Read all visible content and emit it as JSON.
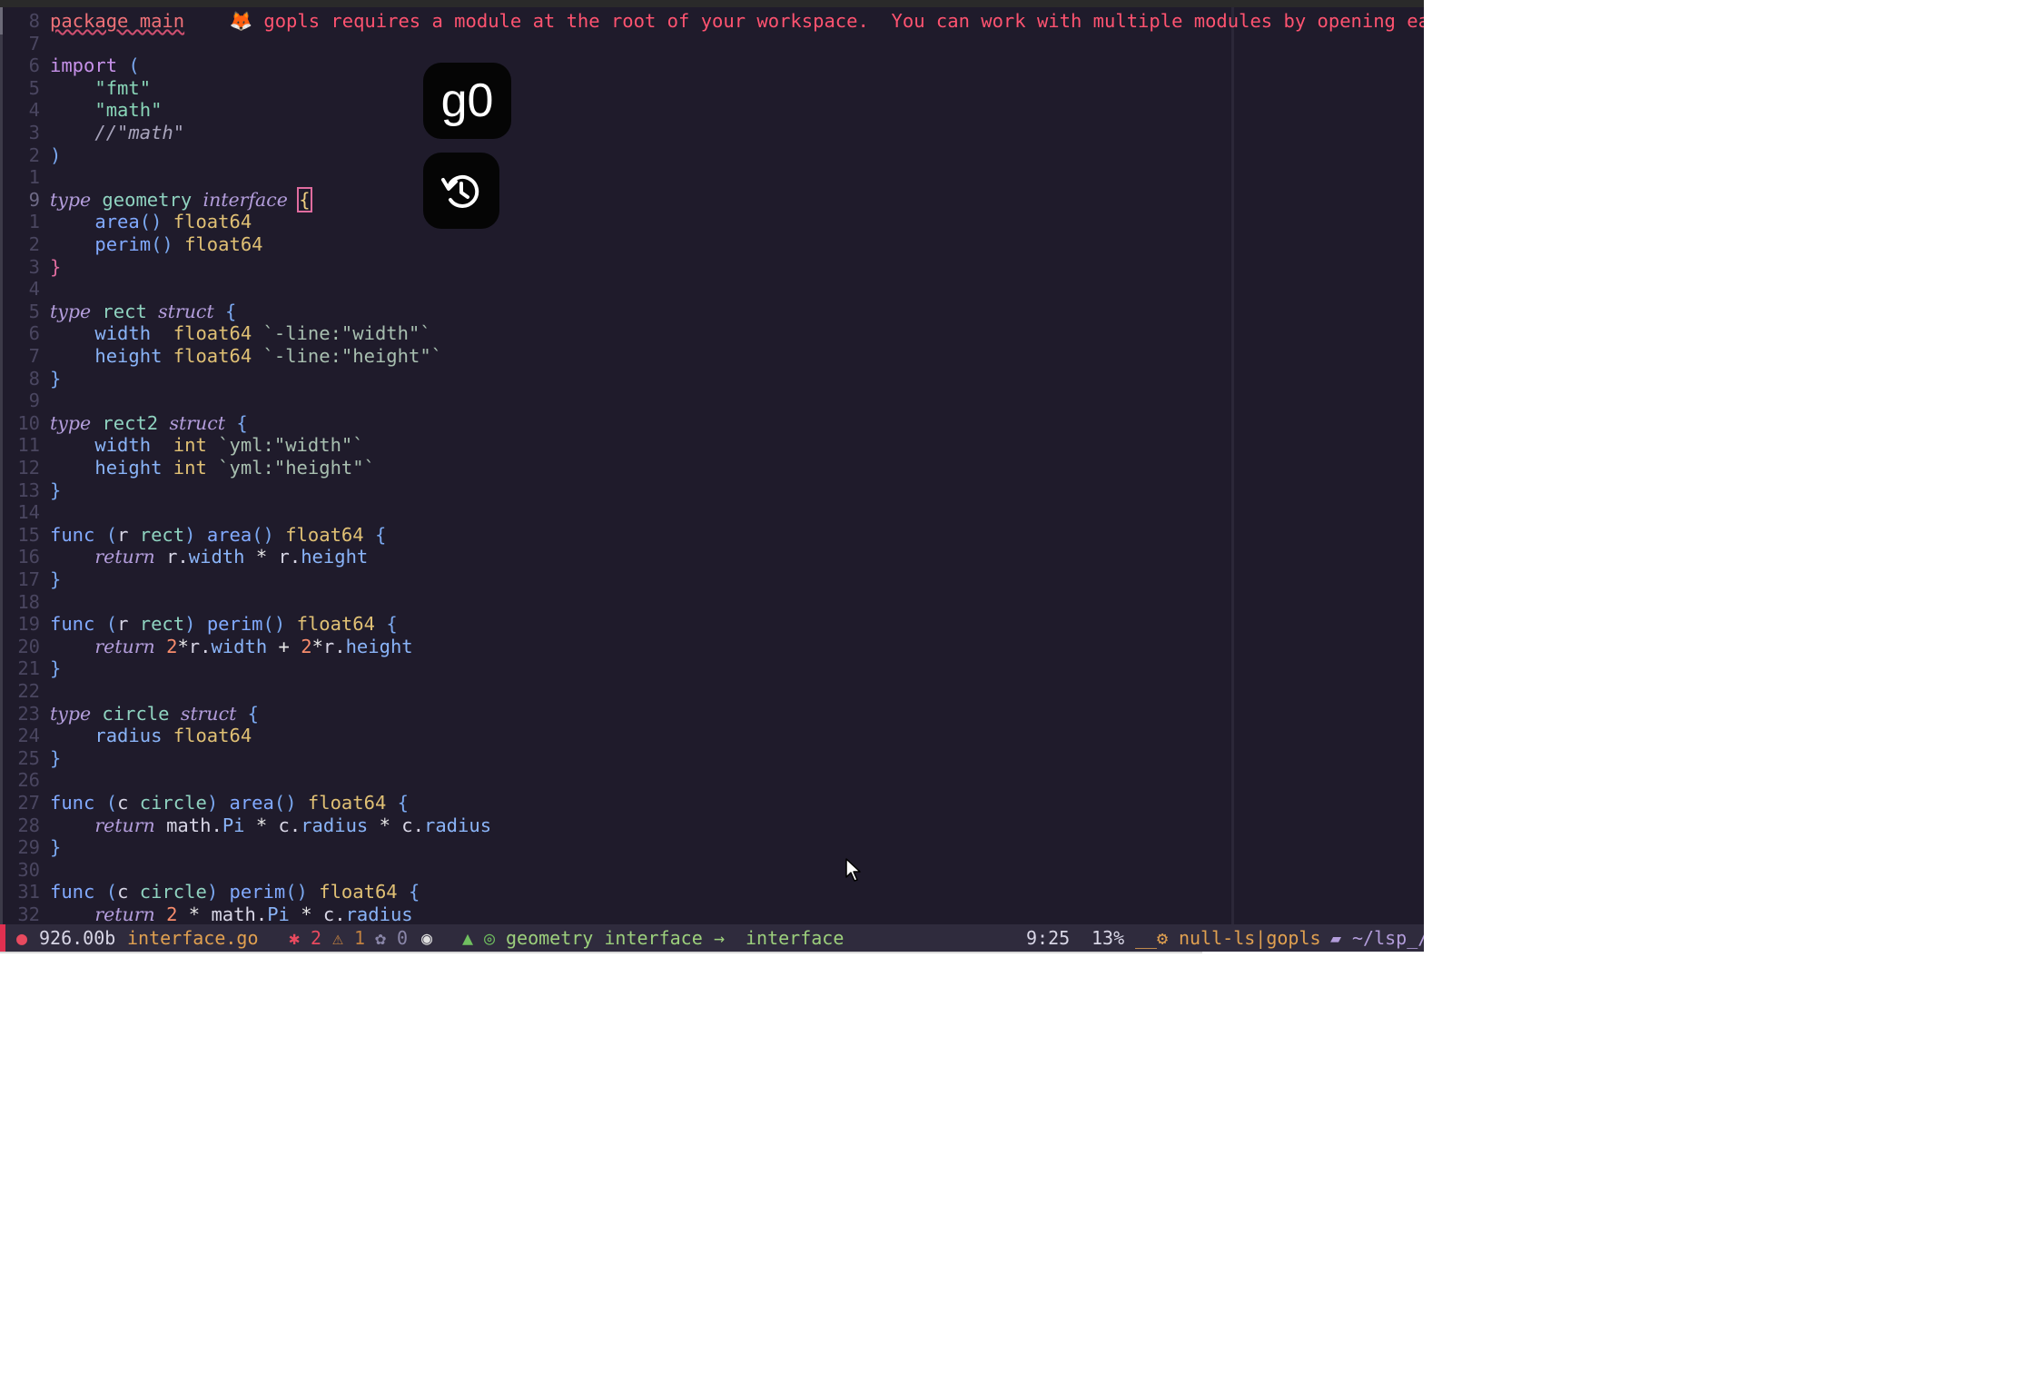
{
  "editor": {
    "lines": [
      {
        "num": "8",
        "tokens": [
          {
            "c": "pkgline",
            "t": "package main"
          },
          {
            "c": "txt",
            "t": "    "
          },
          {
            "c": "diagicon",
            "t": "🦊"
          },
          {
            "c": "diag",
            "t": " gopls requires a module at the root of your workspace.  You can work with multiple modules by opening each one as a workspace folder."
          }
        ]
      },
      {
        "num": "7",
        "tokens": []
      },
      {
        "num": "6",
        "tokens": [
          {
            "c": "kw",
            "t": "import"
          },
          {
            "c": "txt",
            "t": " "
          },
          {
            "c": "br",
            "t": "("
          }
        ]
      },
      {
        "num": "5",
        "tokens": [
          {
            "c": "txt",
            "t": "    "
          },
          {
            "c": "str",
            "t": "\"fmt\""
          }
        ]
      },
      {
        "num": "4",
        "tokens": [
          {
            "c": "txt",
            "t": "    "
          },
          {
            "c": "str",
            "t": "\"math\""
          }
        ]
      },
      {
        "num": "3",
        "tokens": [
          {
            "c": "txt",
            "t": "    "
          },
          {
            "c": "cmt",
            "t": "//\"math\""
          }
        ]
      },
      {
        "num": "2",
        "tokens": [
          {
            "c": "br",
            "t": ")"
          }
        ]
      },
      {
        "num": "1",
        "tokens": []
      },
      {
        "num": "9",
        "cur": true,
        "tokens": [
          {
            "c": "kwi",
            "t": "type"
          },
          {
            "c": "txt",
            "t": " "
          },
          {
            "c": "id",
            "t": "geometry"
          },
          {
            "c": "txt",
            "t": " "
          },
          {
            "c": "kwi",
            "t": "interface"
          },
          {
            "c": "txt",
            "t": " "
          },
          {
            "c": "bracehl",
            "t": "{"
          }
        ]
      },
      {
        "num": "1",
        "tokens": [
          {
            "c": "txt",
            "t": "    "
          },
          {
            "c": "fn",
            "t": "area"
          },
          {
            "c": "br",
            "t": "()"
          },
          {
            "c": "txt",
            "t": " "
          },
          {
            "c": "ty",
            "t": "float64"
          }
        ]
      },
      {
        "num": "2",
        "tokens": [
          {
            "c": "txt",
            "t": "    "
          },
          {
            "c": "fn",
            "t": "perim"
          },
          {
            "c": "br",
            "t": "()"
          },
          {
            "c": "txt",
            "t": " "
          },
          {
            "c": "ty",
            "t": "float64"
          }
        ]
      },
      {
        "num": "3",
        "tokens": [
          {
            "c": "bracepink",
            "t": "}"
          }
        ]
      },
      {
        "num": "4",
        "tokens": []
      },
      {
        "num": "5",
        "tokens": [
          {
            "c": "kwi",
            "t": "type"
          },
          {
            "c": "txt",
            "t": " "
          },
          {
            "c": "id",
            "t": "rect"
          },
          {
            "c": "txt",
            "t": " "
          },
          {
            "c": "kwi",
            "t": "struct"
          },
          {
            "c": "txt",
            "t": " "
          },
          {
            "c": "br",
            "t": "{"
          }
        ]
      },
      {
        "num": "6",
        "tokens": [
          {
            "c": "txt",
            "t": "    "
          },
          {
            "c": "fld",
            "t": "width"
          },
          {
            "c": "txt",
            "t": "  "
          },
          {
            "c": "ty",
            "t": "float64"
          },
          {
            "c": "txt",
            "t": " "
          },
          {
            "c": "tag",
            "t": "`-line:\"width\"`"
          }
        ]
      },
      {
        "num": "7",
        "tokens": [
          {
            "c": "txt",
            "t": "    "
          },
          {
            "c": "fld",
            "t": "height"
          },
          {
            "c": "txt",
            "t": " "
          },
          {
            "c": "ty",
            "t": "float64"
          },
          {
            "c": "txt",
            "t": " "
          },
          {
            "c": "tag",
            "t": "`-line:\"height\"`"
          }
        ]
      },
      {
        "num": "8",
        "tokens": [
          {
            "c": "br",
            "t": "}"
          }
        ]
      },
      {
        "num": "9",
        "tokens": []
      },
      {
        "num": "10",
        "tokens": [
          {
            "c": "kwi",
            "t": "type"
          },
          {
            "c": "txt",
            "t": " "
          },
          {
            "c": "id",
            "t": "rect2"
          },
          {
            "c": "txt",
            "t": " "
          },
          {
            "c": "kwi",
            "t": "struct"
          },
          {
            "c": "txt",
            "t": " "
          },
          {
            "c": "br",
            "t": "{"
          }
        ]
      },
      {
        "num": "11",
        "tokens": [
          {
            "c": "txt",
            "t": "    "
          },
          {
            "c": "fld",
            "t": "width"
          },
          {
            "c": "txt",
            "t": "  "
          },
          {
            "c": "ty",
            "t": "int"
          },
          {
            "c": "txt",
            "t": " "
          },
          {
            "c": "tag",
            "t": "`yml:\"width\"`"
          }
        ]
      },
      {
        "num": "12",
        "tokens": [
          {
            "c": "txt",
            "t": "    "
          },
          {
            "c": "fld",
            "t": "height"
          },
          {
            "c": "txt",
            "t": " "
          },
          {
            "c": "ty",
            "t": "int"
          },
          {
            "c": "txt",
            "t": " "
          },
          {
            "c": "tag",
            "t": "`yml:\"height\"`"
          }
        ]
      },
      {
        "num": "13",
        "tokens": [
          {
            "c": "br",
            "t": "}"
          }
        ]
      },
      {
        "num": "14",
        "tokens": []
      },
      {
        "num": "15",
        "tokens": [
          {
            "c": "fn",
            "t": "func"
          },
          {
            "c": "txt",
            "t": " "
          },
          {
            "c": "br",
            "t": "("
          },
          {
            "c": "txt",
            "t": "r "
          },
          {
            "c": "id",
            "t": "rect"
          },
          {
            "c": "br",
            "t": ")"
          },
          {
            "c": "txt",
            "t": " "
          },
          {
            "c": "fn",
            "t": "area"
          },
          {
            "c": "br",
            "t": "()"
          },
          {
            "c": "txt",
            "t": " "
          },
          {
            "c": "ty",
            "t": "float64"
          },
          {
            "c": "txt",
            "t": " "
          },
          {
            "c": "br",
            "t": "{"
          }
        ]
      },
      {
        "num": "16",
        "tokens": [
          {
            "c": "txt",
            "t": "    "
          },
          {
            "c": "kwi",
            "t": "return"
          },
          {
            "c": "txt",
            "t": " r."
          },
          {
            "c": "fld",
            "t": "width"
          },
          {
            "c": "txt",
            "t": " "
          },
          {
            "c": "op",
            "t": "*"
          },
          {
            "c": "txt",
            "t": " r."
          },
          {
            "c": "fld",
            "t": "height"
          }
        ]
      },
      {
        "num": "17",
        "tokens": [
          {
            "c": "br",
            "t": "}"
          }
        ]
      },
      {
        "num": "18",
        "tokens": []
      },
      {
        "num": "19",
        "tokens": [
          {
            "c": "fn",
            "t": "func"
          },
          {
            "c": "txt",
            "t": " "
          },
          {
            "c": "br",
            "t": "("
          },
          {
            "c": "txt",
            "t": "r "
          },
          {
            "c": "id",
            "t": "rect"
          },
          {
            "c": "br",
            "t": ")"
          },
          {
            "c": "txt",
            "t": " "
          },
          {
            "c": "fn",
            "t": "perim"
          },
          {
            "c": "br",
            "t": "()"
          },
          {
            "c": "txt",
            "t": " "
          },
          {
            "c": "ty",
            "t": "float64"
          },
          {
            "c": "txt",
            "t": " "
          },
          {
            "c": "br",
            "t": "{"
          }
        ]
      },
      {
        "num": "20",
        "tokens": [
          {
            "c": "txt",
            "t": "    "
          },
          {
            "c": "kwi",
            "t": "return"
          },
          {
            "c": "txt",
            "t": " "
          },
          {
            "c": "num",
            "t": "2"
          },
          {
            "c": "op",
            "t": "*"
          },
          {
            "c": "txt",
            "t": "r."
          },
          {
            "c": "fld",
            "t": "width"
          },
          {
            "c": "txt",
            "t": " "
          },
          {
            "c": "op",
            "t": "+"
          },
          {
            "c": "txt",
            "t": " "
          },
          {
            "c": "num",
            "t": "2"
          },
          {
            "c": "op",
            "t": "*"
          },
          {
            "c": "txt",
            "t": "r."
          },
          {
            "c": "fld",
            "t": "height"
          }
        ]
      },
      {
        "num": "21",
        "tokens": [
          {
            "c": "br",
            "t": "}"
          }
        ]
      },
      {
        "num": "22",
        "tokens": []
      },
      {
        "num": "23",
        "tokens": [
          {
            "c": "kwi",
            "t": "type"
          },
          {
            "c": "txt",
            "t": " "
          },
          {
            "c": "id",
            "t": "circle"
          },
          {
            "c": "txt",
            "t": " "
          },
          {
            "c": "kwi",
            "t": "struct"
          },
          {
            "c": "txt",
            "t": " "
          },
          {
            "c": "br",
            "t": "{"
          }
        ]
      },
      {
        "num": "24",
        "tokens": [
          {
            "c": "txt",
            "t": "    "
          },
          {
            "c": "fld",
            "t": "radius"
          },
          {
            "c": "txt",
            "t": " "
          },
          {
            "c": "ty",
            "t": "float64"
          }
        ]
      },
      {
        "num": "25",
        "tokens": [
          {
            "c": "br",
            "t": "}"
          }
        ]
      },
      {
        "num": "26",
        "tokens": []
      },
      {
        "num": "27",
        "tokens": [
          {
            "c": "fn",
            "t": "func"
          },
          {
            "c": "txt",
            "t": " "
          },
          {
            "c": "br",
            "t": "("
          },
          {
            "c": "txt",
            "t": "c "
          },
          {
            "c": "id",
            "t": "circle"
          },
          {
            "c": "br",
            "t": ")"
          },
          {
            "c": "txt",
            "t": " "
          },
          {
            "c": "fn",
            "t": "area"
          },
          {
            "c": "br",
            "t": "()"
          },
          {
            "c": "txt",
            "t": " "
          },
          {
            "c": "ty",
            "t": "float64"
          },
          {
            "c": "txt",
            "t": " "
          },
          {
            "c": "br",
            "t": "{"
          }
        ]
      },
      {
        "num": "28",
        "tokens": [
          {
            "c": "txt",
            "t": "    "
          },
          {
            "c": "kwi",
            "t": "return"
          },
          {
            "c": "txt",
            "t": " math."
          },
          {
            "c": "fld",
            "t": "Pi"
          },
          {
            "c": "txt",
            "t": " "
          },
          {
            "c": "op",
            "t": "*"
          },
          {
            "c": "txt",
            "t": " c."
          },
          {
            "c": "fld",
            "t": "radius"
          },
          {
            "c": "txt",
            "t": " "
          },
          {
            "c": "op",
            "t": "*"
          },
          {
            "c": "txt",
            "t": " c."
          },
          {
            "c": "fld",
            "t": "radius"
          }
        ]
      },
      {
        "num": "29",
        "tokens": [
          {
            "c": "br",
            "t": "}"
          }
        ]
      },
      {
        "num": "30",
        "tokens": []
      },
      {
        "num": "31",
        "tokens": [
          {
            "c": "fn",
            "t": "func"
          },
          {
            "c": "txt",
            "t": " "
          },
          {
            "c": "br",
            "t": "("
          },
          {
            "c": "txt",
            "t": "c "
          },
          {
            "c": "id",
            "t": "circle"
          },
          {
            "c": "br",
            "t": ")"
          },
          {
            "c": "txt",
            "t": " "
          },
          {
            "c": "fn",
            "t": "perim"
          },
          {
            "c": "br",
            "t": "()"
          },
          {
            "c": "txt",
            "t": " "
          },
          {
            "c": "ty",
            "t": "float64"
          },
          {
            "c": "txt",
            "t": " "
          },
          {
            "c": "br",
            "t": "{"
          }
        ]
      },
      {
        "num": "32",
        "tokens": [
          {
            "c": "txt",
            "t": "    "
          },
          {
            "c": "kwi",
            "t": "return"
          },
          {
            "c": "txt",
            "t": " "
          },
          {
            "c": "num",
            "t": "2"
          },
          {
            "c": "txt",
            "t": " "
          },
          {
            "c": "op",
            "t": "*"
          },
          {
            "c": "txt",
            "t": " math."
          },
          {
            "c": "fld",
            "t": "Pi"
          },
          {
            "c": "txt",
            "t": " "
          },
          {
            "c": "op",
            "t": "*"
          },
          {
            "c": "txt",
            "t": " c."
          },
          {
            "c": "fld",
            "t": "radius"
          }
        ]
      }
    ]
  },
  "keycast": {
    "keys": "g0",
    "undo_icon": "undo-clock-icon"
  },
  "statusbar": {
    "mode_icon": "ladybug-icon",
    "file_size": "926.00b",
    "file_name": "interface.go",
    "errors_icon": "bug-icon",
    "errors": "2",
    "warnings_icon": "warning-icon",
    "warnings": "1",
    "hints_icon": "palette-icon",
    "hints": "0",
    "panda_icon": "panda-icon",
    "tree_icon": "tree-icon",
    "owl_icon": "owl-icon",
    "breadcrumb_symbol": "geometry interface",
    "breadcrumb_arrow": "→",
    "breadcrumb_kind": "interface",
    "position": "9:25",
    "percent": "13%",
    "lsp_sep": "__",
    "gear_icon": "gear-icon",
    "lsp": "null-ls|gopls",
    "folder_icon": "folder-icon",
    "cwd": "~/lsp_/"
  },
  "colors": {
    "background": "#1f1b2b",
    "statusbar": "#2f2b3d",
    "diagnostic": "#ff5370",
    "accent_orange": "#e0a050"
  }
}
